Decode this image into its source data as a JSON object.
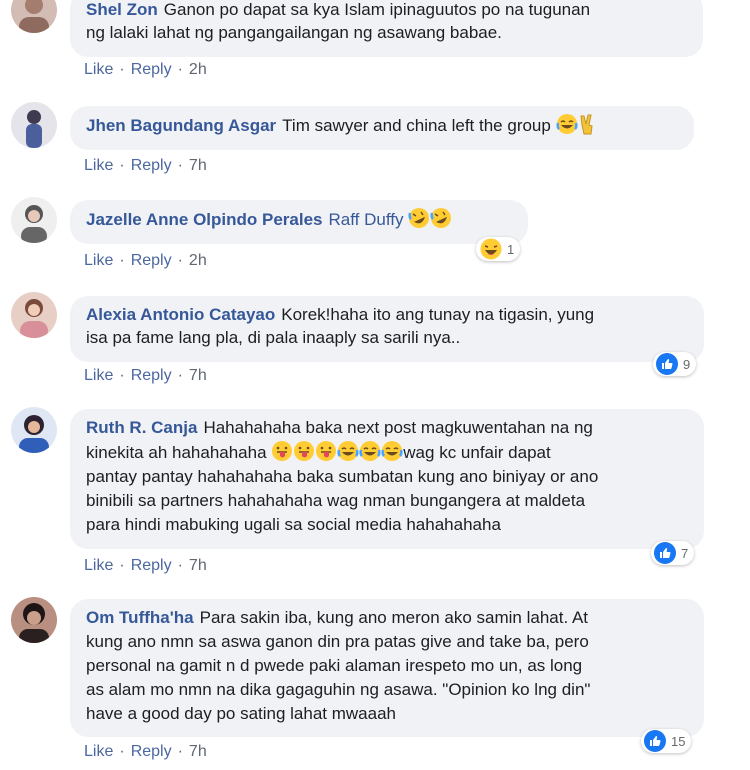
{
  "comments": [
    {
      "name": "Shel Zon",
      "lines": [
        "Ganon po dapat sa kya Islam ipinaguutos po na tugunan",
        "ng lalaki lahat ng pangangailangan ng asawang babae."
      ],
      "time": "2h",
      "avatar_color": "#c9a99a"
    },
    {
      "name": "Jhen Bagundang Asgar",
      "text": "Tim sawyer and china left the group",
      "emoji": [
        "face-with-tears-of-joy-icon",
        "victory-hand-icon"
      ],
      "time": "7h",
      "avatar_color": "#5a5f8c"
    },
    {
      "name": "Jazelle Anne Olpindo Perales",
      "mention": "Raff Duffy",
      "emoji": [
        "rolling-on-floor-laughing-icon",
        "rolling-on-floor-laughing-icon"
      ],
      "time": "2h",
      "reaction_count": "1",
      "reaction_icon": "haha-reaction-icon",
      "avatar_color": "#d8d8d8"
    },
    {
      "name": "Alexia Antonio Catayao",
      "lines": [
        "Korek!haha ito ang tunay na tigasin, yung",
        "isa pa fame lang pla, di pala inaaply sa sarili nya.."
      ],
      "time": "7h",
      "reaction_count": "9",
      "reaction_icon": "like-reaction-icon",
      "avatar_color": "#d9b3a3"
    },
    {
      "name": "Ruth R. Canja",
      "line1": "Hahahahaha baka next post magkuwentahan na ng",
      "line2_start": "kinekita ah hahahahaha",
      "line2_end": "wag kc unfair dapat",
      "line2_emoji": [
        "tongue-out-face-icon",
        "tongue-out-face-icon",
        "tongue-out-face-icon",
        "face-with-tears-of-joy-icon",
        "face-with-tears-of-joy-icon",
        "face-with-tears-of-joy-icon"
      ],
      "lines_rest": [
        "pantay pantay hahahahaha baka sumbatan kung ano biniyay or ano",
        "binibili sa partners hahahahaha wag nman bungangera at maldeta",
        "para hindi mabuking ugali sa social media hahahahaha"
      ],
      "time": "7h",
      "reaction_count": "7",
      "reaction_icon": "like-reaction-icon",
      "avatar_color": "#3a4e8a"
    },
    {
      "name": "Om Tuffha'ha",
      "lines": [
        "Para sakin iba, kung ano meron ako samin lahat. At",
        "kung ano nmn sa aswa ganon din pra patas give and take ba, pero",
        "personal na gamit n d pwede paki alaman irespeto mo un, as long",
        "as alam mo nmn na dika gagaguhin ng asawa. \"Opinion ko lng din\"",
        "have a good day po sating lahat mwaaah"
      ],
      "time": "7h",
      "reaction_count": "15",
      "reaction_icon": "like-reaction-icon",
      "avatar_color": "#3b2b2a"
    }
  ],
  "labels": {
    "like": "Like",
    "reply": "Reply",
    "dot": "·"
  },
  "colors": {
    "bubble": "#f0f2f5",
    "name": "#365899",
    "like_blue": "#1877f2"
  }
}
